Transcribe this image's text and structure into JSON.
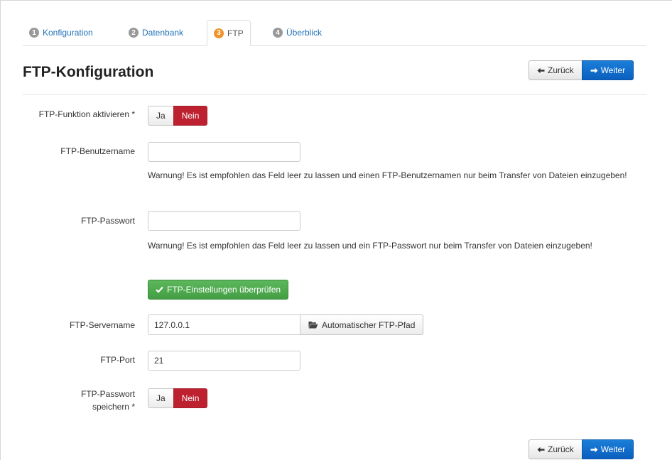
{
  "tabs": [
    {
      "num": "1",
      "label": "Konfiguration"
    },
    {
      "num": "2",
      "label": "Datenbank"
    },
    {
      "num": "3",
      "label": "FTP"
    },
    {
      "num": "4",
      "label": "Überblick"
    }
  ],
  "active_tab": "FTP",
  "header": {
    "title": "FTP-Konfiguration",
    "back_label": "Zurück",
    "next_label": "Weiter"
  },
  "form": {
    "ftp_enable": {
      "label": "FTP-Funktion aktivieren *",
      "yes": "Ja",
      "no": "Nein",
      "selected": "Nein"
    },
    "ftp_user": {
      "label": "FTP-Benutzername",
      "value": "",
      "warning": "Warnung! Es ist empfohlen das Feld leer zu lassen und einen FTP-Benutzernamen nur beim Transfer von Dateien einzugeben!"
    },
    "ftp_pass": {
      "label": "FTP-Passwort",
      "value": "",
      "warning": "Warnung! Es ist empfohlen das Feld leer zu lassen und ein FTP-Passwort nur beim Transfer von Dateien einzugeben!"
    },
    "check_button": "FTP-Einstellungen überprüfen",
    "ftp_host": {
      "label": "FTP-Servername",
      "value": "127.0.0.1",
      "auto_button": "Automatischer FTP-Pfad"
    },
    "ftp_port": {
      "label": "FTP-Port",
      "value": "21"
    },
    "ftp_save": {
      "label_line1": "FTP-Passwort",
      "label_line2": "speichern *",
      "yes": "Ja",
      "no": "Nein",
      "selected": "Nein"
    }
  },
  "footer": {
    "back_label": "Zurück",
    "next_label": "Weiter"
  },
  "colors": {
    "link": "#1f71b8",
    "active_badge": "#f0932b",
    "primary": "#0b5fbf",
    "danger": "#bd2130",
    "success": "#449d44"
  }
}
